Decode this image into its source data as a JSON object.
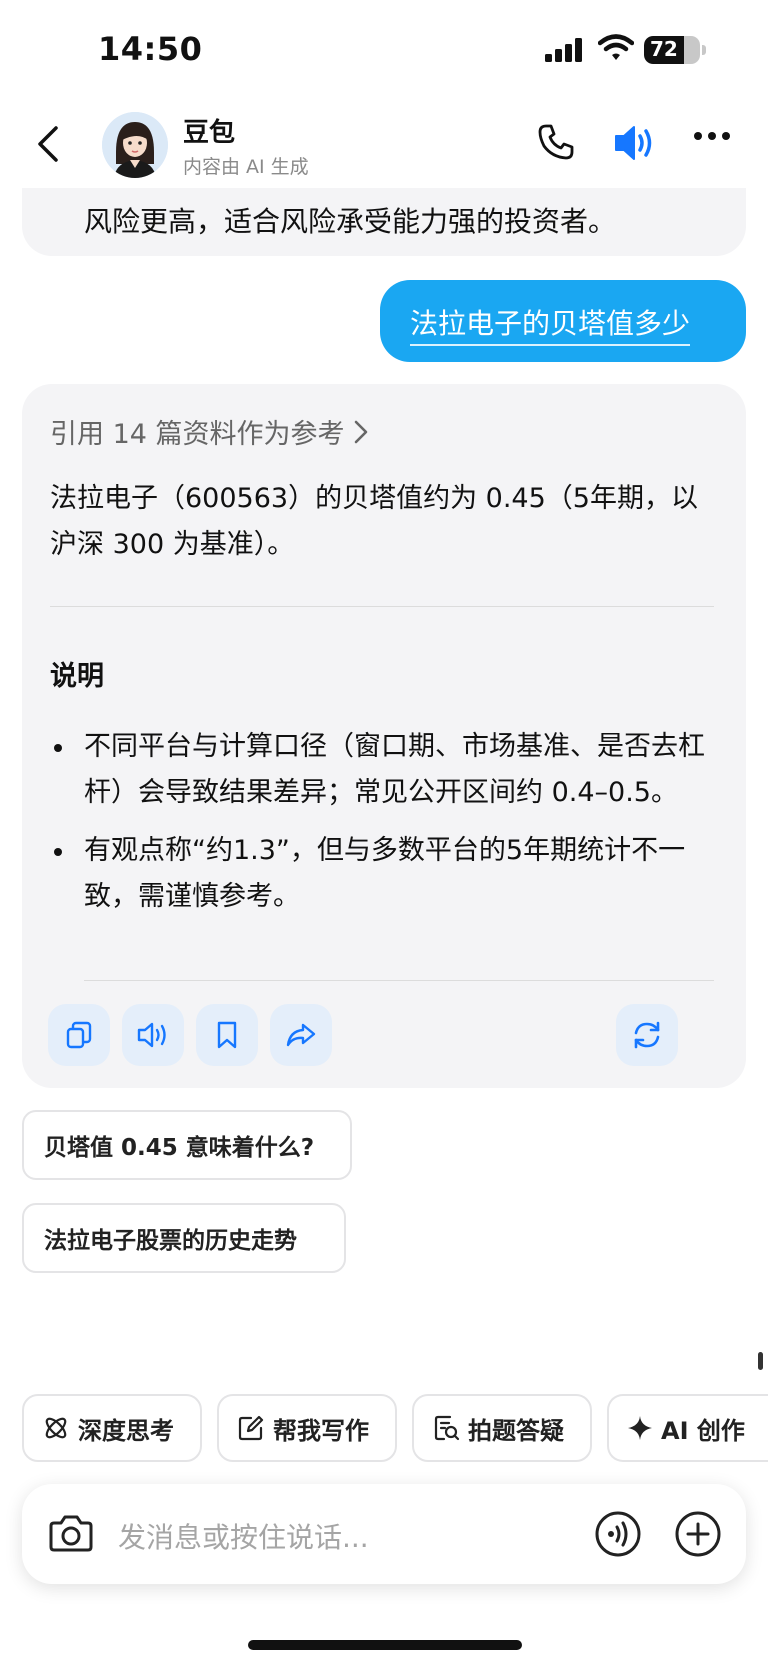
{
  "status": {
    "time": "14:50",
    "battery": "72",
    "battery_level": 0.72
  },
  "header": {
    "bot_name": "豆包",
    "subtitle": "内容由 AI 生成"
  },
  "messages": {
    "previous_tail": "风险更高，适合风险承受能力强的投资者。",
    "user_question": "法拉电子的贝塔值多少",
    "reply": {
      "references": "引用 14 篇资料作为参考",
      "answer": "法拉电子（600563）的贝塔值约为 0.45（5年期，以沪深 300 为基准）。",
      "note_title": "说明",
      "bullets": [
        "不同平台与计算口径（窗口期、市场基准、是否去杠杆）会导致结果差异；常见公开区间约 0.4–0.5。",
        "有观点称“约1.3”，但与多数平台的5年期统计不一致，需谨慎参考。"
      ]
    }
  },
  "suggestions": [
    "贝塔值 0.45 意味着什么?",
    "法拉电子股票的历史走势"
  ],
  "quick_actions": [
    {
      "label": "深度思考",
      "icon": "atom-icon"
    },
    {
      "label": "帮我写作",
      "icon": "edit-icon"
    },
    {
      "label": "拍题答疑",
      "icon": "scan-question-icon"
    },
    {
      "label": "AI 创作",
      "icon": "sparkle-icon"
    }
  ],
  "input": {
    "placeholder": "发消息或按住说话..."
  },
  "colors": {
    "accent": "#1aa7f2",
    "speaker_blue": "#1677ff",
    "bubble_gray": "#f4f4f6",
    "action_bg": "#e4eefa"
  }
}
